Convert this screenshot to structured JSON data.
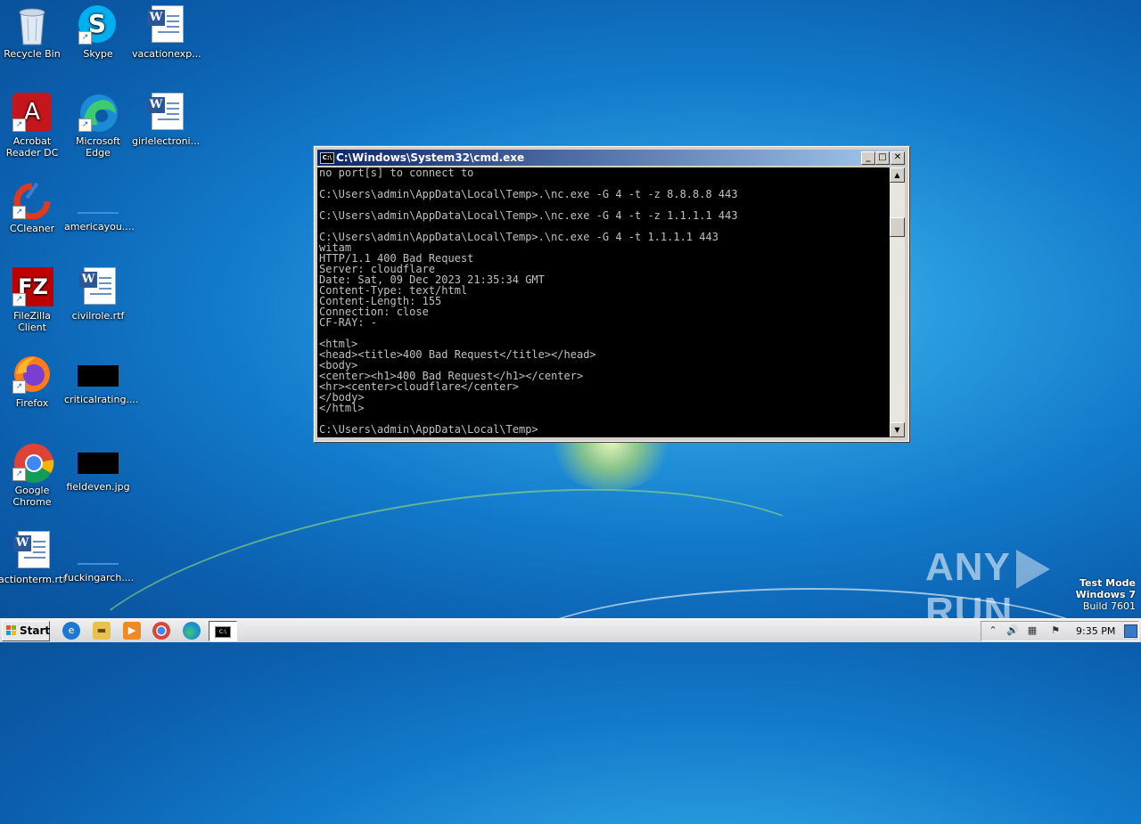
{
  "desktop": {
    "icons": [
      {
        "label": "Recycle Bin",
        "icon": "recycle-bin-icon"
      },
      {
        "label": "Skype",
        "icon": "skype-icon"
      },
      {
        "label": "vacationexp...",
        "icon": "word-document-icon"
      },
      {
        "label": "Acrobat Reader DC",
        "icon": "acrobat-reader-icon"
      },
      {
        "label": "Microsoft Edge",
        "icon": "edge-icon"
      },
      {
        "label": "girlelectroni...",
        "icon": "word-document-icon"
      },
      {
        "label": "CCleaner",
        "icon": "ccleaner-icon"
      },
      {
        "label": "americayou....",
        "icon": "file-icon"
      },
      {
        "label": "FileZilla Client",
        "icon": "filezilla-icon"
      },
      {
        "label": "civilrole.rtf",
        "icon": "word-document-icon"
      },
      {
        "label": "Firefox",
        "icon": "firefox-icon"
      },
      {
        "label": "criticalrating....",
        "icon": "image-file-icon"
      },
      {
        "label": "Google Chrome",
        "icon": "chrome-icon"
      },
      {
        "label": "fieldeven.jpg",
        "icon": "image-file-icon"
      },
      {
        "label": "actionterm.rtf",
        "icon": "word-document-icon"
      },
      {
        "label": "fuckingarch....",
        "icon": "file-icon"
      }
    ]
  },
  "cmd_window": {
    "title": "C:\\Windows\\System32\\cmd.exe",
    "controls": {
      "minimize": "_",
      "maximize": "□",
      "close": "✕"
    },
    "lines": [
      "no port[s] to connect to",
      "",
      "C:\\Users\\admin\\AppData\\Local\\Temp>.\\nc.exe -G 4 -t -z 8.8.8.8 443",
      "",
      "C:\\Users\\admin\\AppData\\Local\\Temp>.\\nc.exe -G 4 -t -z 1.1.1.1 443",
      "",
      "C:\\Users\\admin\\AppData\\Local\\Temp>.\\nc.exe -G 4 -t 1.1.1.1 443",
      "witam",
      "HTTP/1.1 400 Bad Request",
      "Server: cloudflare",
      "Date: Sat, 09 Dec 2023 21:35:34 GMT",
      "Content-Type: text/html",
      "Content-Length: 155",
      "Connection: close",
      "CF-RAY: -",
      "",
      "<html>",
      "<head><title>400 Bad Request</title></head>",
      "<body>",
      "<center><h1>400 Bad Request</h1></center>",
      "<hr><center>cloudflare</center>",
      "</body>",
      "</html>",
      "",
      "C:\\Users\\admin\\AppData\\Local\\Temp>"
    ]
  },
  "watermark": {
    "brand_left": "ANY",
    "brand_right": "RUN",
    "test_mode": "Test Mode",
    "os": "Windows 7",
    "build": "Build 7601"
  },
  "taskbar": {
    "start_label": "Start",
    "quick_launch": [
      "internet-explorer-icon",
      "file-explorer-icon",
      "media-player-icon",
      "chrome-icon",
      "edge-icon"
    ],
    "active_task": "cmd-icon",
    "clock": "9:35 PM",
    "tray_icons": [
      "show-hidden-icons-arrow",
      "volume-icon",
      "network-icon",
      "action-center-flag-icon"
    ]
  },
  "colors": {
    "titlebar_start": "#0a246a",
    "titlebar_end": "#a6caf0",
    "console_bg": "#000000",
    "console_fg": "#c0c0c0"
  }
}
